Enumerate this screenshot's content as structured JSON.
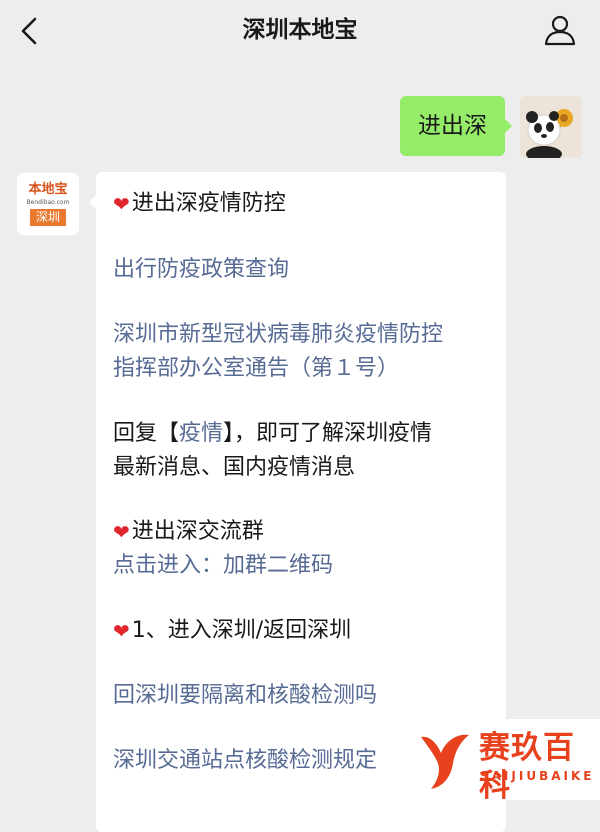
{
  "nav": {
    "title": "深圳本地宝",
    "back_icon": "chevron-left-icon",
    "user_icon": "person-icon"
  },
  "outgoing": {
    "text": "进出深"
  },
  "bot_avatar": {
    "logo_top": "本地宝",
    "logo_mid": "Bendibao.com",
    "logo_bottom": "深圳"
  },
  "message": {
    "heart_icon": "heart-icon",
    "section1_title": "进出深疫情防控",
    "link_policy": "出行防疫政策查询",
    "link_notice_line1": "深圳市新型冠状病毒肺炎疫情防控",
    "link_notice_line2": "指挥部办公室通告（第１号）",
    "reply_prefix": "回复【",
    "reply_keyword": "疫情",
    "reply_suffix": "】，即可了解深圳疫情",
    "reply_line2": "最新消息、国内疫情消息",
    "section2_title": "进出深交流群",
    "join_prefix": "点击进入：",
    "join_link": "加群二维码",
    "section3_title": "1、进入深圳/返回深圳",
    "link_quarantine": "回深圳要隔离和核酸检测吗",
    "link_station": "深圳交通站点核酸检测规定"
  },
  "watermark": {
    "name": "赛玖百科",
    "pinyin": "SAIJIUBAIKE"
  },
  "colors": {
    "background": "#ededed",
    "outgoing_bubble": "#95ec69",
    "link": "#576b95",
    "heart": "#e0272d",
    "watermark": "#e8411d"
  }
}
